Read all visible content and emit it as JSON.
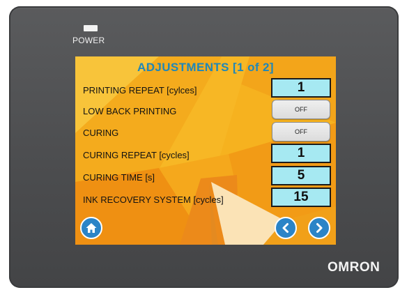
{
  "device": {
    "power_label": "POWER",
    "brand": "OMRON"
  },
  "screen": {
    "title": "ADJUSTMENTS [1 of 2]",
    "rows": [
      {
        "label": "PRINTING REPEAT [cylces]",
        "value": "1"
      },
      {
        "label": "LOW BACK PRINTING",
        "value": "OFF"
      },
      {
        "label": "CURING",
        "value": "OFF"
      },
      {
        "label": "CURING REPEAT [cycles]",
        "value": "1"
      },
      {
        "label": "CURING TIME [s]",
        "value": "5"
      },
      {
        "label": "INK RECOVERY SYSTEM [cycles]",
        "value": "15"
      }
    ]
  },
  "icons": {
    "home": "home-icon",
    "prev": "chevron-left-icon",
    "next": "chevron-right-icon"
  },
  "colors": {
    "screen_background": "#f6b21f",
    "title": "#1f87b9",
    "value_box": "#a6e9f2",
    "nav_button": "#2b84c7",
    "bezel": "#4f5052"
  }
}
